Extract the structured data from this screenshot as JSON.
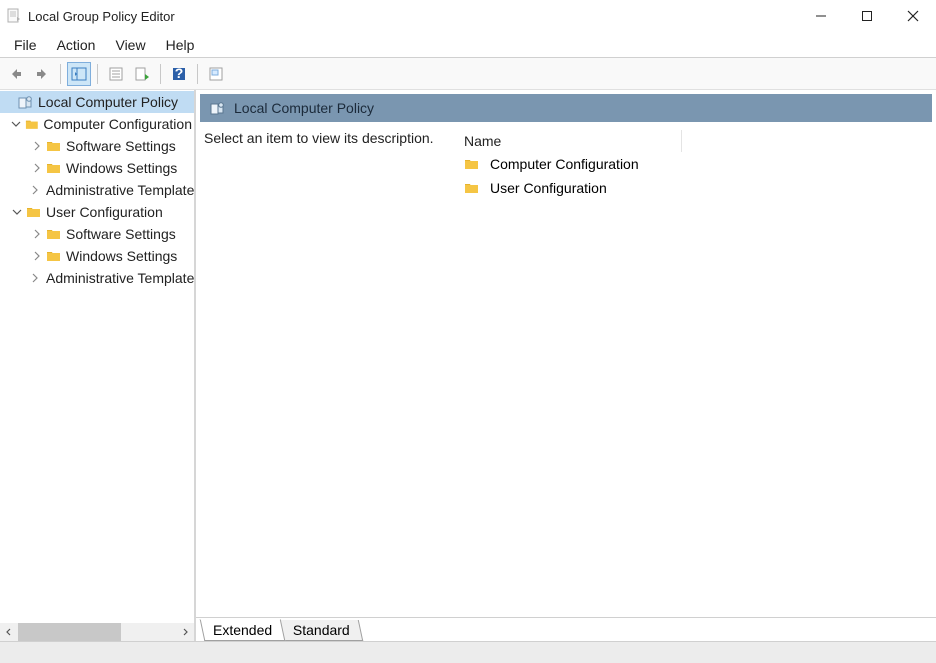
{
  "window": {
    "title": "Local Group Policy Editor"
  },
  "menu": {
    "file": "File",
    "action": "Action",
    "view": "View",
    "help": "Help"
  },
  "tree": {
    "root": "Local Computer Policy",
    "computer_config": "Computer Configuration",
    "cc_software": "Software Settings",
    "cc_windows": "Windows Settings",
    "cc_admin": "Administrative Templates",
    "user_config": "User Configuration",
    "uc_software": "Software Settings",
    "uc_windows": "Windows Settings",
    "uc_admin": "Administrative Templates"
  },
  "content": {
    "header_title": "Local Computer Policy",
    "description_prompt": "Select an item to view its description.",
    "columns": {
      "name": "Name"
    },
    "items": [
      {
        "label": "Computer Configuration"
      },
      {
        "label": "User Configuration"
      }
    ]
  },
  "tabs": {
    "extended": "Extended",
    "standard": "Standard"
  }
}
